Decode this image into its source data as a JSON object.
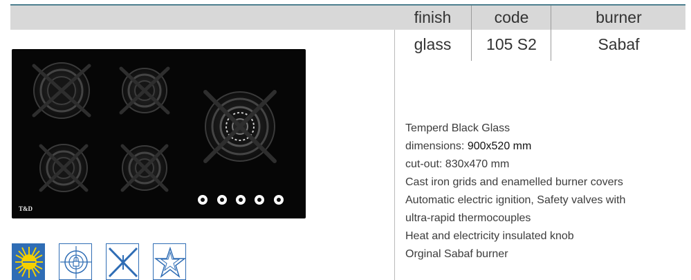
{
  "table": {
    "headers": [
      "finish",
      "code",
      "burner"
    ],
    "values": [
      "glass",
      "105 S2",
      "Sabaf"
    ]
  },
  "product": {
    "brand": "T&D"
  },
  "description": {
    "line1": "Temperd Black Glass",
    "dimensions_label": "dimensions: ",
    "dimensions_value": "900x520 mm",
    "line3": "cut-out: 830x470 mm",
    "line4": "Cast iron grids and enamelled burner covers",
    "line5": "Automatic electric ignition, Safety valves with",
    "line6": "ultra-rapid thermocouples",
    "line7": "Heat and electricity insulated knob",
    "line8": "Orginal Sabaf burner"
  },
  "badges": [
    "sabaf-sun-icon",
    "gas-safety-lock-icon",
    "cast-iron-grid-icon",
    "star-icon"
  ],
  "colors": {
    "accent_rule": "#4d7f8f",
    "header_band": "#d8d8d8",
    "badge_blue": "#2f6db5",
    "cooktop": "#060606"
  }
}
